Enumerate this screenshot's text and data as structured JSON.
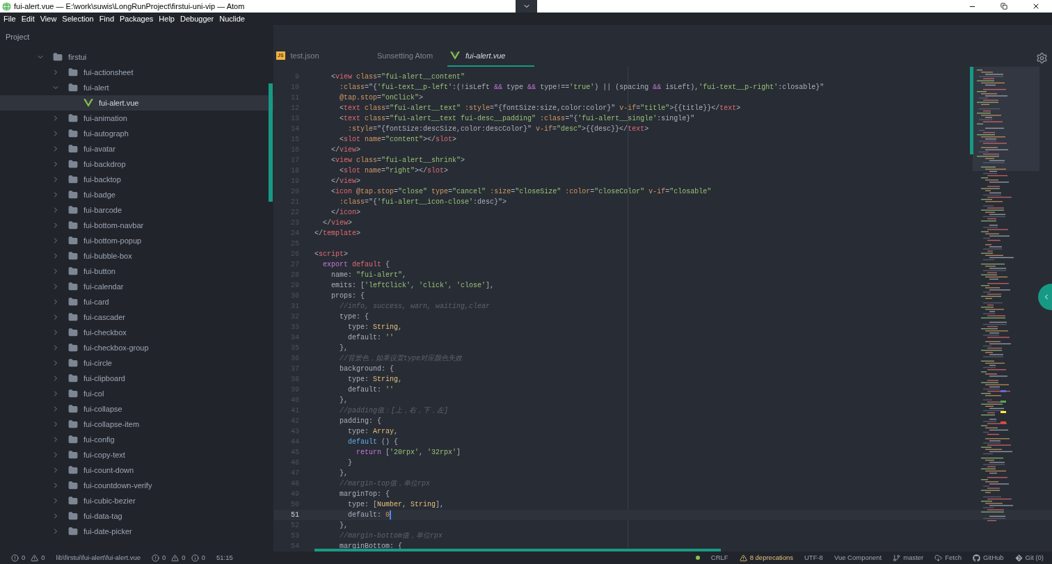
{
  "window": {
    "title": "fui-alert.vue — E:\\work\\suwis\\LongRunProject\\firstui-uni-vip — Atom"
  },
  "menu": [
    "File",
    "Edit",
    "View",
    "Selection",
    "Find",
    "Packages",
    "Help",
    "Debugger",
    "Nuclide"
  ],
  "sidebar": {
    "title": "Project"
  },
  "tree": {
    "label": "firstui",
    "kind": "folder",
    "expanded": true,
    "children": [
      {
        "label": "fui-actionsheet",
        "kind": "folder",
        "expanded": false
      },
      {
        "label": "fui-alert",
        "kind": "folder",
        "expanded": true,
        "children": [
          {
            "label": "fui-alert.vue",
            "kind": "vue-file",
            "selected": true
          }
        ]
      },
      {
        "label": "fui-animation",
        "kind": "folder",
        "expanded": false
      },
      {
        "label": "fui-autograph",
        "kind": "folder",
        "expanded": false
      },
      {
        "label": "fui-avatar",
        "kind": "folder",
        "expanded": false
      },
      {
        "label": "fui-backdrop",
        "kind": "folder",
        "expanded": false
      },
      {
        "label": "fui-backtop",
        "kind": "folder",
        "expanded": false
      },
      {
        "label": "fui-badge",
        "kind": "folder",
        "expanded": false
      },
      {
        "label": "fui-barcode",
        "kind": "folder",
        "expanded": false
      },
      {
        "label": "fui-bottom-navbar",
        "kind": "folder",
        "expanded": false
      },
      {
        "label": "fui-bottom-popup",
        "kind": "folder",
        "expanded": false
      },
      {
        "label": "fui-bubble-box",
        "kind": "folder",
        "expanded": false
      },
      {
        "label": "fui-button",
        "kind": "folder",
        "expanded": false
      },
      {
        "label": "fui-calendar",
        "kind": "folder",
        "expanded": false
      },
      {
        "label": "fui-card",
        "kind": "folder",
        "expanded": false
      },
      {
        "label": "fui-cascader",
        "kind": "folder",
        "expanded": false
      },
      {
        "label": "fui-checkbox",
        "kind": "folder",
        "expanded": false
      },
      {
        "label": "fui-checkbox-group",
        "kind": "folder",
        "expanded": false
      },
      {
        "label": "fui-circle",
        "kind": "folder",
        "expanded": false
      },
      {
        "label": "fui-clipboard",
        "kind": "folder",
        "expanded": false
      },
      {
        "label": "fui-col",
        "kind": "folder",
        "expanded": false
      },
      {
        "label": "fui-collapse",
        "kind": "folder",
        "expanded": false
      },
      {
        "label": "fui-collapse-item",
        "kind": "folder",
        "expanded": false
      },
      {
        "label": "fui-config",
        "kind": "folder",
        "expanded": false
      },
      {
        "label": "fui-copy-text",
        "kind": "folder",
        "expanded": false
      },
      {
        "label": "fui-count-down",
        "kind": "folder",
        "expanded": false
      },
      {
        "label": "fui-countdown-verify",
        "kind": "folder",
        "expanded": false
      },
      {
        "label": "fui-cubic-bezier",
        "kind": "folder",
        "expanded": false
      },
      {
        "label": "fui-data-tag",
        "kind": "folder",
        "expanded": false
      },
      {
        "label": "fui-date-picker",
        "kind": "folder",
        "expanded": false
      }
    ]
  },
  "tabs": [
    {
      "label": "test.json",
      "kind": "js",
      "badge": "JS",
      "selected": false
    },
    {
      "label": "Sunsetting Atom",
      "kind": "plain",
      "selected": false
    },
    {
      "label": "fui-alert.vue",
      "kind": "vue",
      "selected": true
    }
  ],
  "code": [
    {
      "number": "9",
      "tokens": [
        {
          "text": "    <",
          "kind": "p"
        },
        {
          "text": "view",
          "kind": "tag"
        },
        {
          "text": " class",
          "kind": "attr"
        },
        {
          "text": "=",
          "kind": "p"
        },
        {
          "text": "\"fui-alert__content\"",
          "kind": "str"
        }
      ]
    },
    {
      "number": "10",
      "tokens": [
        {
          "text": "      :class",
          "kind": "attr"
        },
        {
          "text": "=\"{",
          "kind": "p"
        },
        {
          "text": "'fui-text__p-left'",
          "kind": "str"
        },
        {
          "text": ":(!isLeft ",
          "kind": "p"
        },
        {
          "text": "&&",
          "kind": "kw"
        },
        {
          "text": " type ",
          "kind": "p"
        },
        {
          "text": "&&",
          "kind": "kw"
        },
        {
          "text": " type!==",
          "kind": "p"
        },
        {
          "text": "'true'",
          "kind": "str"
        },
        {
          "text": ") || (spacing ",
          "kind": "p"
        },
        {
          "text": "&&",
          "kind": "kw"
        },
        {
          "text": " isLeft),",
          "kind": "p"
        },
        {
          "text": "'fui-text__p-right'",
          "kind": "str"
        },
        {
          "text": ":closable}\"",
          "kind": "p"
        }
      ]
    },
    {
      "number": "11",
      "tokens": [
        {
          "text": "      @tap.stop",
          "kind": "attr"
        },
        {
          "text": "=",
          "kind": "p"
        },
        {
          "text": "\"onClick\"",
          "kind": "str"
        },
        {
          "text": ">",
          "kind": "p"
        }
      ]
    },
    {
      "number": "12",
      "tokens": [
        {
          "text": "      <",
          "kind": "p"
        },
        {
          "text": "text",
          "kind": "tag"
        },
        {
          "text": " class",
          "kind": "attr"
        },
        {
          "text": "=",
          "kind": "p"
        },
        {
          "text": "\"fui-alert__text\"",
          "kind": "str"
        },
        {
          "text": " :style",
          "kind": "attr"
        },
        {
          "text": "=\"{fontSize:size,color:color}\" ",
          "kind": "p"
        },
        {
          "text": "v-if",
          "kind": "attr"
        },
        {
          "text": "=",
          "kind": "p"
        },
        {
          "text": "\"title\"",
          "kind": "str"
        },
        {
          "text": ">{{title}}</",
          "kind": "p"
        },
        {
          "text": "text",
          "kind": "tag"
        },
        {
          "text": ">",
          "kind": "p"
        }
      ]
    },
    {
      "number": "13",
      "tokens": [
        {
          "text": "      <",
          "kind": "p"
        },
        {
          "text": "text",
          "kind": "tag"
        },
        {
          "text": " class",
          "kind": "attr"
        },
        {
          "text": "=",
          "kind": "p"
        },
        {
          "text": "\"fui-alert__text fui-desc__padding\"",
          "kind": "str"
        },
        {
          "text": " :class",
          "kind": "attr"
        },
        {
          "text": "=\"{",
          "kind": "p"
        },
        {
          "text": "'fui-alert__single'",
          "kind": "str"
        },
        {
          "text": ":single}\"",
          "kind": "p"
        }
      ]
    },
    {
      "number": "14",
      "tokens": [
        {
          "text": "        :style",
          "kind": "attr"
        },
        {
          "text": "=\"{fontSize:descSize,color:descColor}\" ",
          "kind": "p"
        },
        {
          "text": "v-if",
          "kind": "attr"
        },
        {
          "text": "=",
          "kind": "p"
        },
        {
          "text": "\"desc\"",
          "kind": "str"
        },
        {
          "text": ">{{desc}}</",
          "kind": "p"
        },
        {
          "text": "text",
          "kind": "tag"
        },
        {
          "text": ">",
          "kind": "p"
        }
      ]
    },
    {
      "number": "15",
      "tokens": [
        {
          "text": "      <",
          "kind": "p"
        },
        {
          "text": "slot",
          "kind": "tag"
        },
        {
          "text": " name",
          "kind": "attr"
        },
        {
          "text": "=",
          "kind": "p"
        },
        {
          "text": "\"content\"",
          "kind": "str"
        },
        {
          "text": "></",
          "kind": "p"
        },
        {
          "text": "slot",
          "kind": "tag"
        },
        {
          "text": ">",
          "kind": "p"
        }
      ]
    },
    {
      "number": "16",
      "tokens": [
        {
          "text": "    </",
          "kind": "p"
        },
        {
          "text": "view",
          "kind": "tag"
        },
        {
          "text": ">",
          "kind": "p"
        }
      ]
    },
    {
      "number": "17",
      "tokens": [
        {
          "text": "    <",
          "kind": "p"
        },
        {
          "text": "view",
          "kind": "tag"
        },
        {
          "text": " class",
          "kind": "attr"
        },
        {
          "text": "=",
          "kind": "p"
        },
        {
          "text": "\"fui-alert__shrink\"",
          "kind": "str"
        },
        {
          "text": ">",
          "kind": "p"
        }
      ]
    },
    {
      "number": "18",
      "tokens": [
        {
          "text": "      <",
          "kind": "p"
        },
        {
          "text": "slot",
          "kind": "tag"
        },
        {
          "text": " name",
          "kind": "attr"
        },
        {
          "text": "=",
          "kind": "p"
        },
        {
          "text": "\"right\"",
          "kind": "str"
        },
        {
          "text": "></",
          "kind": "p"
        },
        {
          "text": "slot",
          "kind": "tag"
        },
        {
          "text": ">",
          "kind": "p"
        }
      ]
    },
    {
      "number": "19",
      "tokens": [
        {
          "text": "    </",
          "kind": "p"
        },
        {
          "text": "view",
          "kind": "tag"
        },
        {
          "text": ">",
          "kind": "p"
        }
      ]
    },
    {
      "number": "20",
      "tokens": [
        {
          "text": "    <",
          "kind": "p"
        },
        {
          "text": "icon",
          "kind": "tag"
        },
        {
          "text": " @tap.stop",
          "kind": "attr"
        },
        {
          "text": "=",
          "kind": "p"
        },
        {
          "text": "\"close\"",
          "kind": "str"
        },
        {
          "text": " type",
          "kind": "attr"
        },
        {
          "text": "=",
          "kind": "p"
        },
        {
          "text": "\"cancel\"",
          "kind": "str"
        },
        {
          "text": " :size",
          "kind": "attr"
        },
        {
          "text": "=",
          "kind": "p"
        },
        {
          "text": "\"closeSize\"",
          "kind": "str"
        },
        {
          "text": " :color",
          "kind": "attr"
        },
        {
          "text": "=",
          "kind": "p"
        },
        {
          "text": "\"closeColor\"",
          "kind": "str"
        },
        {
          "text": " v-if",
          "kind": "attr"
        },
        {
          "text": "=",
          "kind": "p"
        },
        {
          "text": "\"closable\"",
          "kind": "str"
        }
      ]
    },
    {
      "number": "21",
      "tokens": [
        {
          "text": "      :class",
          "kind": "attr"
        },
        {
          "text": "=\"{",
          "kind": "p"
        },
        {
          "text": "'fui-alert__icon-close'",
          "kind": "str"
        },
        {
          "text": ":desc}\">",
          "kind": "p"
        }
      ]
    },
    {
      "number": "22",
      "tokens": [
        {
          "text": "    </",
          "kind": "p"
        },
        {
          "text": "icon",
          "kind": "tag"
        },
        {
          "text": ">",
          "kind": "p"
        }
      ]
    },
    {
      "number": "23",
      "tokens": [
        {
          "text": "  </",
          "kind": "p"
        },
        {
          "text": "view",
          "kind": "tag"
        },
        {
          "text": ">",
          "kind": "p"
        }
      ]
    },
    {
      "number": "24",
      "tokens": [
        {
          "text": "</",
          "kind": "p"
        },
        {
          "text": "template",
          "kind": "tag"
        },
        {
          "text": ">",
          "kind": "p"
        }
      ]
    },
    {
      "number": "25"
    },
    {
      "number": "26",
      "tokens": [
        {
          "text": "<",
          "kind": "p"
        },
        {
          "text": "script",
          "kind": "tag"
        },
        {
          "text": ">",
          "kind": "p"
        }
      ]
    },
    {
      "number": "27",
      "tokens": [
        {
          "text": "  export",
          "kind": "kw"
        },
        {
          "text": " default",
          "kind": "tag"
        },
        {
          "text": " {",
          "kind": "p"
        }
      ]
    },
    {
      "number": "28",
      "tokens": [
        {
          "text": "    name: ",
          "kind": "p"
        },
        {
          "text": "\"fui-alert\"",
          "kind": "str"
        },
        {
          "text": ",",
          "kind": "p"
        }
      ]
    },
    {
      "number": "29",
      "tokens": [
        {
          "text": "    emits: [",
          "kind": "p"
        },
        {
          "text": "'leftClick'",
          "kind": "str"
        },
        {
          "text": ", ",
          "kind": "p"
        },
        {
          "text": "'click'",
          "kind": "str"
        },
        {
          "text": ", ",
          "kind": "p"
        },
        {
          "text": "'close'",
          "kind": "str"
        },
        {
          "text": "],",
          "kind": "p"
        }
      ]
    },
    {
      "number": "30",
      "tokens": [
        {
          "text": "    props: {",
          "kind": "p"
        }
      ]
    },
    {
      "number": "31",
      "tokens": [
        {
          "text": "      //info, success, warn, waiting,clear",
          "kind": "cmt"
        }
      ]
    },
    {
      "number": "32",
      "tokens": [
        {
          "text": "      type: {",
          "kind": "p"
        }
      ]
    },
    {
      "number": "33",
      "tokens": [
        {
          "text": "        type: ",
          "kind": "p"
        },
        {
          "text": "String",
          "kind": "type"
        },
        {
          "text": ",",
          "kind": "p"
        }
      ]
    },
    {
      "number": "34",
      "tokens": [
        {
          "text": "        default: ",
          "kind": "p"
        },
        {
          "text": "''",
          "kind": "str"
        }
      ]
    },
    {
      "number": "35",
      "tokens": [
        {
          "text": "      },",
          "kind": "p"
        }
      ]
    },
    {
      "number": "36",
      "tokens": [
        {
          "text": "      //背景色，如果设置type对应颜色失效",
          "kind": "cmt"
        }
      ]
    },
    {
      "number": "37",
      "tokens": [
        {
          "text": "      background: {",
          "kind": "p"
        }
      ]
    },
    {
      "number": "38",
      "tokens": [
        {
          "text": "        type: ",
          "kind": "p"
        },
        {
          "text": "String",
          "kind": "type"
        },
        {
          "text": ",",
          "kind": "p"
        }
      ]
    },
    {
      "number": "39",
      "tokens": [
        {
          "text": "        default: ",
          "kind": "p"
        },
        {
          "text": "''",
          "kind": "str"
        }
      ]
    },
    {
      "number": "40",
      "tokens": [
        {
          "text": "      },",
          "kind": "p"
        }
      ]
    },
    {
      "number": "41",
      "tokens": [
        {
          "text": "      //padding值：[上，右，下，左]",
          "kind": "cmt"
        }
      ]
    },
    {
      "number": "42",
      "tokens": [
        {
          "text": "      padding: {",
          "kind": "p"
        }
      ]
    },
    {
      "number": "43",
      "tokens": [
        {
          "text": "        type: ",
          "kind": "p"
        },
        {
          "text": "Array",
          "kind": "type"
        },
        {
          "text": ",",
          "kind": "p"
        }
      ]
    },
    {
      "number": "44",
      "tokens": [
        {
          "text": "        default",
          "kind": "fn"
        },
        {
          "text": " () {",
          "kind": "p"
        }
      ]
    },
    {
      "number": "45",
      "tokens": [
        {
          "text": "          return",
          "kind": "kw"
        },
        {
          "text": " [",
          "kind": "p"
        },
        {
          "text": "'20rpx'",
          "kind": "str"
        },
        {
          "text": ", ",
          "kind": "p"
        },
        {
          "text": "'32rpx'",
          "kind": "str"
        },
        {
          "text": "]",
          "kind": "p"
        }
      ]
    },
    {
      "number": "46",
      "tokens": [
        {
          "text": "        }",
          "kind": "p"
        }
      ]
    },
    {
      "number": "47",
      "tokens": [
        {
          "text": "      },",
          "kind": "p"
        }
      ]
    },
    {
      "number": "48",
      "tokens": [
        {
          "text": "      //margin-top值，单位rpx",
          "kind": "cmt"
        }
      ]
    },
    {
      "number": "49",
      "tokens": [
        {
          "text": "      marginTop: {",
          "kind": "p"
        }
      ]
    },
    {
      "number": "50",
      "tokens": [
        {
          "text": "        type: [",
          "kind": "p"
        },
        {
          "text": "Number",
          "kind": "type"
        },
        {
          "text": ", ",
          "kind": "p"
        },
        {
          "text": "String",
          "kind": "type"
        },
        {
          "text": "],",
          "kind": "p"
        }
      ]
    },
    {
      "number": "51",
      "current": true,
      "tokens": [
        {
          "text": "        default: ",
          "kind": "p"
        },
        {
          "text": "0",
          "kind": "num"
        }
      ]
    },
    {
      "number": "52",
      "tokens": [
        {
          "text": "      },",
          "kind": "p"
        }
      ]
    },
    {
      "number": "53",
      "tokens": [
        {
          "text": "      //margin-bottom值，单位rpx",
          "kind": "cmt"
        }
      ]
    },
    {
      "number": "54",
      "tokens": [
        {
          "text": "      marginBottom: {",
          "kind": "p"
        }
      ]
    }
  ],
  "status_bar": {
    "left": [
      {
        "kind": "error",
        "text": "0"
      },
      {
        "kind": "warning",
        "text": "0"
      },
      {
        "kind": "path",
        "text": "lib\\firstui\\fui-alert\\fui-alert.vue"
      },
      {
        "kind": "error",
        "text": "0"
      },
      {
        "kind": "warning",
        "text": "0"
      },
      {
        "kind": "info",
        "text": "0"
      },
      {
        "kind": "cursor",
        "text": "51:15"
      }
    ],
    "right": [
      {
        "kind": "dot"
      },
      {
        "kind": "plain",
        "text": "CRLF"
      },
      {
        "kind": "deprecations",
        "text": "8 deprecations"
      },
      {
        "kind": "plain",
        "text": "UTF-8"
      },
      {
        "kind": "plain",
        "text": "Vue Component"
      },
      {
        "kind": "branch",
        "text": "master"
      },
      {
        "kind": "fetch",
        "text": "Fetch"
      },
      {
        "kind": "github",
        "text": "GitHub"
      },
      {
        "kind": "git",
        "text": "Git (0)"
      }
    ]
  }
}
